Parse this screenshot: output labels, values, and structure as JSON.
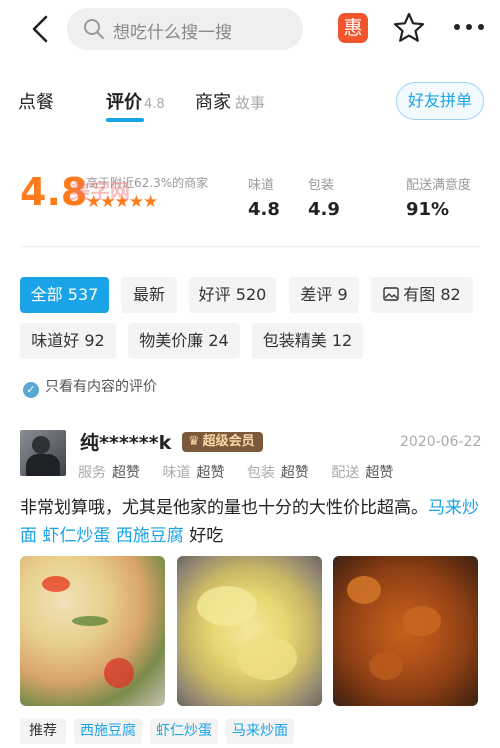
{
  "search": {
    "placeholder": "想吃什么搜一搜"
  },
  "header": {
    "coupon_label": "惠"
  },
  "tabs": {
    "order": "点餐",
    "review": "评价",
    "review_score": "4.8",
    "merchant": "商家",
    "merchant_sub": "故事",
    "friend_button": "好友拼单"
  },
  "rating": {
    "score": "4.8",
    "above_text": "高于附近62.3%的商家",
    "stars": "★★★★★",
    "watermark": "美字网",
    "taste_label": "味道",
    "taste_value": "4.8",
    "package_label": "包装",
    "package_value": "4.9",
    "delivery_label": "配送满意度",
    "delivery_value": "91%"
  },
  "filters": [
    {
      "label": "全部 537"
    },
    {
      "label": "最新"
    },
    {
      "label": "好评 520"
    },
    {
      "label": "差评 9"
    },
    {
      "label": "有图 82"
    },
    {
      "label": "味道好 92"
    },
    {
      "label": "物美价廉 24"
    },
    {
      "label": "包装精美 12"
    }
  ],
  "only_content": "只看有内容的评价",
  "review": {
    "username": "纯******k",
    "vip": "超级会员",
    "date": "2020-06-22",
    "subscores": [
      {
        "label": "服务",
        "value": "超赞"
      },
      {
        "label": "味道",
        "value": "超赞"
      },
      {
        "label": "包装",
        "value": "超赞"
      },
      {
        "label": "配送",
        "value": "超赞"
      }
    ],
    "text_prefix": "非常划算哦，尤其是他家的量也十分的大性价比超高。",
    "dishes": [
      "马来炒面",
      "虾仁炒蛋",
      "西施豆腐"
    ],
    "text_suffix": "好吃",
    "recommend_label": "推荐",
    "recommend": [
      "西施豆腐",
      "虾仁炒蛋",
      "马来炒面"
    ]
  },
  "colors": {
    "accent": "#1aa3e8",
    "score": "#ff7c1e",
    "coupon": "#f2542d"
  }
}
